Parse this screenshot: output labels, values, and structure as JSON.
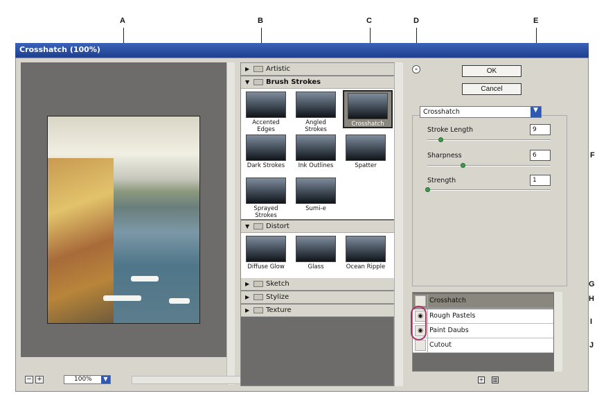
{
  "window": {
    "title": "Crosshatch (100%)"
  },
  "callouts": [
    "A",
    "B",
    "C",
    "D",
    "E",
    "F",
    "G",
    "H",
    "I",
    "J"
  ],
  "preview": {
    "zoom": "100%"
  },
  "gallery": {
    "folders": [
      {
        "label": "Artistic",
        "expanded": false
      },
      {
        "label": "Brush Strokes",
        "expanded": true,
        "filters": [
          "Accented Edges",
          "Angled Strokes",
          "Crosshatch",
          "Dark Strokes",
          "Ink Outlines",
          "Spatter",
          "Sprayed Strokes",
          "Sumi-e"
        ],
        "selected": "Crosshatch"
      },
      {
        "label": "Distort",
        "expanded": true,
        "filters": [
          "Diffuse Glow",
          "Glass",
          "Ocean Ripple"
        ]
      },
      {
        "label": "Sketch",
        "expanded": false
      },
      {
        "label": "Stylize",
        "expanded": false
      },
      {
        "label": "Texture",
        "expanded": false
      }
    ]
  },
  "buttons": {
    "ok": "OK",
    "cancel": "Cancel"
  },
  "filter_select": {
    "value": "Crosshatch"
  },
  "params": [
    {
      "label": "Stroke Length",
      "value": "9",
      "level": 0.11
    },
    {
      "label": "Sharpness",
      "value": "6",
      "level": 0.3
    },
    {
      "label": "Strength",
      "value": "1",
      "level": 0.0
    }
  ],
  "layers": [
    {
      "name": "Crosshatch",
      "visible": false,
      "selected": true
    },
    {
      "name": "Rough Pastels",
      "visible": true,
      "selected": false
    },
    {
      "name": "Paint Daubs",
      "visible": true,
      "selected": false
    },
    {
      "name": "Cutout",
      "visible": false,
      "selected": false
    }
  ],
  "icons": {
    "new_layer": "new-layer-icon",
    "delete": "trash-icon"
  }
}
